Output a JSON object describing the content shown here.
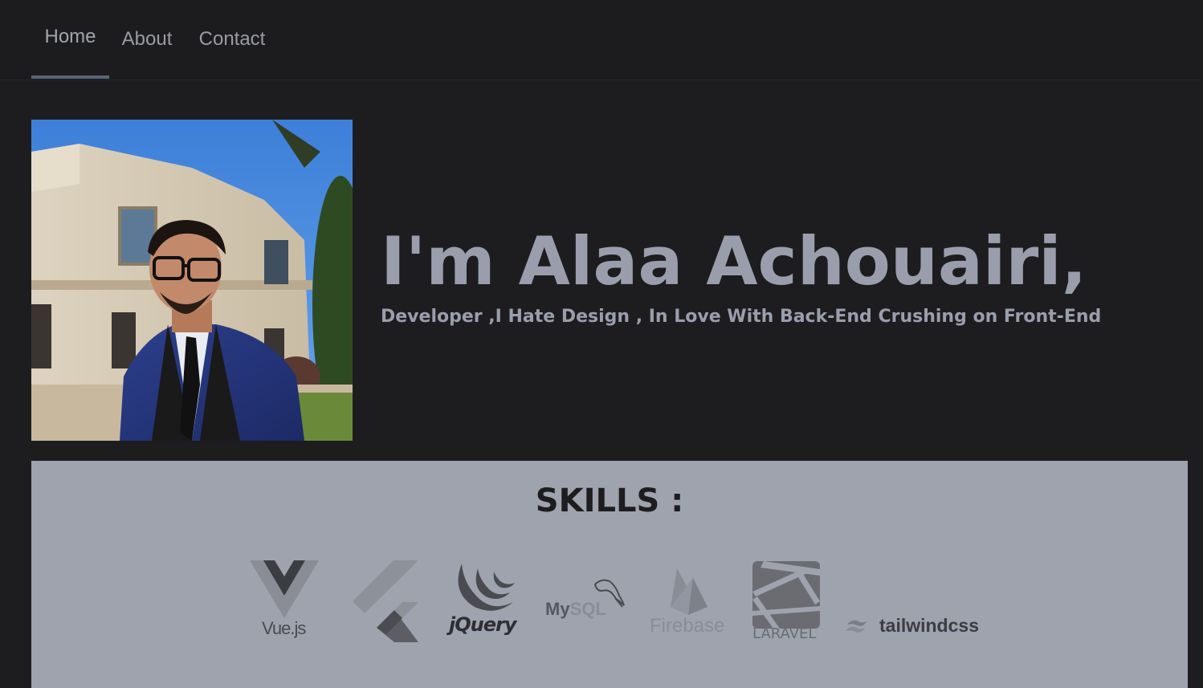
{
  "nav": {
    "tabs": [
      {
        "label": "Home",
        "active": true
      },
      {
        "label": "About",
        "active": false
      },
      {
        "label": "Contact",
        "active": false
      }
    ],
    "active_indicator_color": "#5a6576"
  },
  "hero": {
    "title": "I'm Alaa Achouairi,",
    "subtitle": "Developer ,I Hate Design , In Love With Back-End Crushing on Front-End",
    "text_color": "#9a9eac"
  },
  "skills": {
    "title": "SKILLS :",
    "background": "#9ea3ae",
    "logos": [
      {
        "name": "vuejs",
        "text": "Vue.js"
      },
      {
        "name": "flutter",
        "text": ""
      },
      {
        "name": "jquery",
        "text": "jQuery"
      },
      {
        "name": "mysql",
        "text_my": "My",
        "text_sql": "SQL"
      },
      {
        "name": "firebase",
        "text": "Firebase"
      },
      {
        "name": "laravel",
        "text": "LARAVEL"
      },
      {
        "name": "tailwindcss",
        "text": "tailwindcss"
      }
    ]
  }
}
